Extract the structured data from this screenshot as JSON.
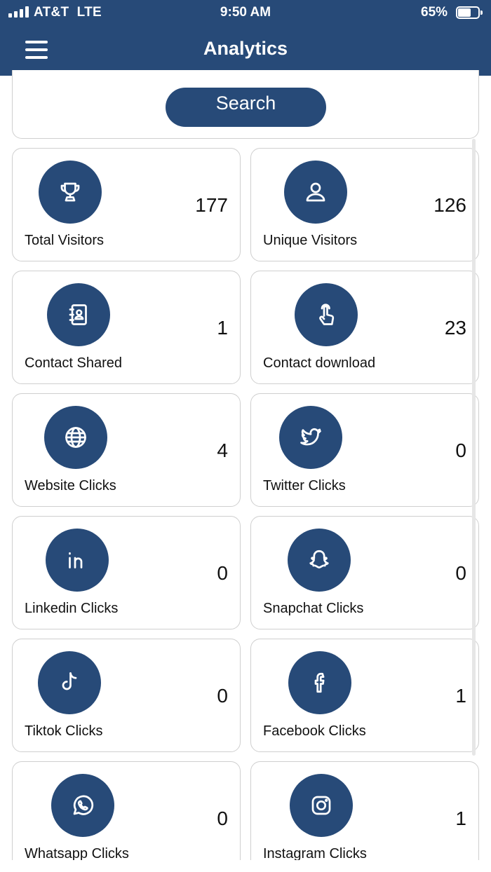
{
  "status_bar": {
    "carrier": "AT&T  LTE",
    "time": "9:50 AM",
    "battery": "65%",
    "battery_level": 0.65
  },
  "header": {
    "title": "Analytics",
    "menu_icon": "hamburger-menu-icon"
  },
  "search": {
    "label": "Search"
  },
  "accent_color": "#274a78",
  "cards": [
    {
      "label": "Total Visitors",
      "value": "177",
      "icon": "trophy-icon"
    },
    {
      "label": "Unique Visitors",
      "value": "126",
      "icon": "user-icon"
    },
    {
      "label": "Contact Shared",
      "value": "1",
      "icon": "contact-book-icon"
    },
    {
      "label": "Contact download",
      "value": "23",
      "icon": "tap-hand-icon"
    },
    {
      "label": "Website Clicks",
      "value": "4",
      "icon": "globe-icon"
    },
    {
      "label": "Twitter Clicks",
      "value": "0",
      "icon": "twitter-icon"
    },
    {
      "label": "Linkedin Clicks",
      "value": "0",
      "icon": "linkedin-icon"
    },
    {
      "label": "Snapchat Clicks",
      "value": "0",
      "icon": "snapchat-icon"
    },
    {
      "label": "Tiktok Clicks",
      "value": "0",
      "icon": "tiktok-icon"
    },
    {
      "label": "Facebook Clicks",
      "value": "1",
      "icon": "facebook-icon"
    },
    {
      "label": "Whatsapp Clicks",
      "value": "0",
      "icon": "whatsapp-icon"
    },
    {
      "label": "Instagram Clicks",
      "value": "1",
      "icon": "instagram-icon"
    }
  ]
}
